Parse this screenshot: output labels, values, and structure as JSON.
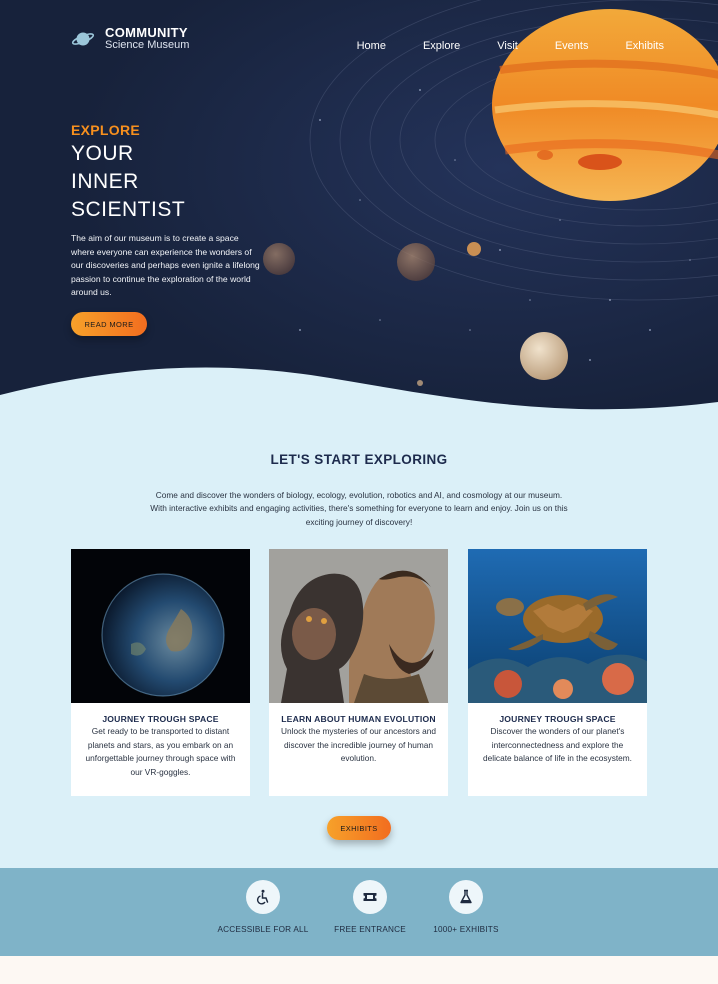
{
  "brand": {
    "title": "COMMUNITY",
    "subtitle": "Science Museum",
    "icon": "planet-icon"
  },
  "nav": {
    "items": [
      "Home",
      "Explore",
      "Visit",
      "Events",
      "Exhibits"
    ]
  },
  "hero": {
    "kicker": "EXPLORE",
    "title_line1": "YOUR",
    "title_line2": "INNER",
    "title_line3": "SCIENTIST",
    "text": "The aim of our museum is to create a space where everyone can experience the wonders of our discoveries and perhaps even ignite a lifelong passion to continue the exploration of the world around us.",
    "button": "READ MORE"
  },
  "explore": {
    "title": "LET'S START EXPLORING",
    "text": "Come and discover the wonders of biology, ecology, evolution, robotics and AI, and cosmology at our museum. With interactive exhibits and engaging activities, there's something for everyone to learn and enjoy. Join us on this exciting journey of discovery!",
    "cards": [
      {
        "title": "JOURNEY TROUGH SPACE",
        "text": "Get ready to be transported to distant planets and stars, as you embark on an unforgettable journey through space with our VR-goggles."
      },
      {
        "title": "LEARN ABOUT HUMAN EVOLUTION",
        "text": "Unlock the mysteries of our ancestors and discover the incredible journey of human evolution."
      },
      {
        "title": "JOURNEY TROUGH SPACE",
        "text": "Discover the wonders of our planet's interconnectedness and explore the delicate balance of life in the ecosystem."
      }
    ],
    "button": "EXHIBITS"
  },
  "features": [
    {
      "label": "ACCESSIBLE FOR ALL",
      "icon": "wheelchair-icon"
    },
    {
      "label": "FREE ENTRANCE",
      "icon": "ticket-icon"
    },
    {
      "label": "1000+ EXHIBITS",
      "icon": "flask-icon"
    }
  ],
  "colors": {
    "navy": "#17223b",
    "accent": "#f7901e",
    "light_blue": "#dbf0f8",
    "feature_blue": "#7fb3c8"
  }
}
